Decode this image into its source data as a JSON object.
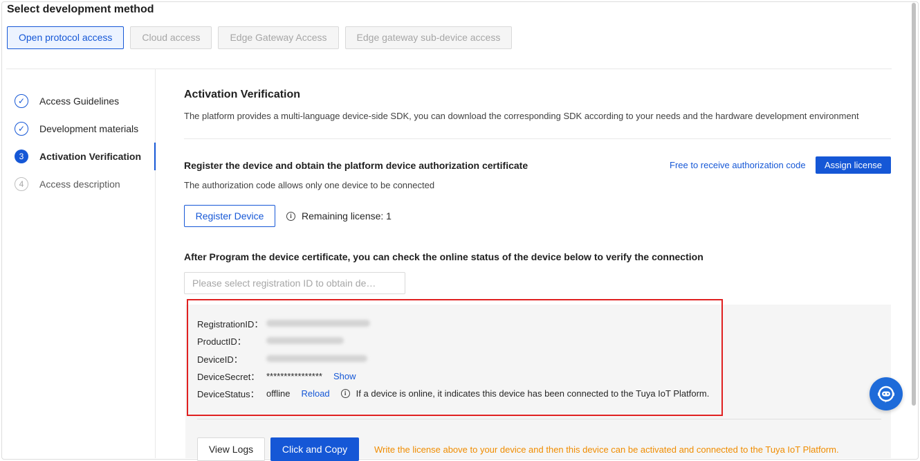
{
  "page": {
    "title": "Select development method"
  },
  "method_tabs": [
    {
      "label": "Open protocol access",
      "active": true
    },
    {
      "label": "Cloud access",
      "active": false
    },
    {
      "label": "Edge Gateway Access",
      "active": false
    },
    {
      "label": "Edge gateway sub-device access",
      "active": false
    }
  ],
  "steps": [
    {
      "marker": "✓",
      "label": "Access Guidelines",
      "state": "done"
    },
    {
      "marker": "✓",
      "label": "Development materials",
      "state": "done"
    },
    {
      "marker": "3",
      "label": "Activation Verification",
      "state": "current"
    },
    {
      "marker": "4",
      "label": "Access description",
      "state": "pending"
    }
  ],
  "activation": {
    "title": "Activation Verification",
    "description": "The platform provides a multi-language device-side SDK, you can download the corresponding SDK according to your needs and the hardware development environment"
  },
  "register": {
    "title": "Register the device and obtain the platform device authorization certificate",
    "free_link": "Free to receive authorization code",
    "assign_button": "Assign license",
    "note": "The authorization code allows only one device to be connected",
    "register_button": "Register Device",
    "remaining_label": "Remaining license: 1"
  },
  "verify": {
    "title": "After Program the device certificate, you can check the online status of the device below to verify the connection",
    "select_placeholder": "Please select registration ID to obtain de…"
  },
  "device_info": {
    "registration_id_label": "RegistrationID：",
    "product_id_label": "ProductID：",
    "device_id_label": "DeviceID：",
    "device_secret_label": "DeviceSecret：",
    "device_secret_value": "****************",
    "show_link": "Show",
    "device_status_label": "DeviceStatus：",
    "device_status_value": "offline",
    "reload_link": "Reload",
    "status_hint": "If a device is online, it indicates this device has been connected to the Tuya IoT Platform."
  },
  "actions": {
    "view_logs": "View Logs",
    "click_copy": "Click and Copy",
    "warning": "Write the license above to your device and then this device can be activated and connected to the Tuya IoT Platform."
  },
  "colors": {
    "accent": "#1557d6",
    "highlight_border": "#e02020",
    "warning": "#f08c00",
    "fab": "#1e6bd9"
  }
}
